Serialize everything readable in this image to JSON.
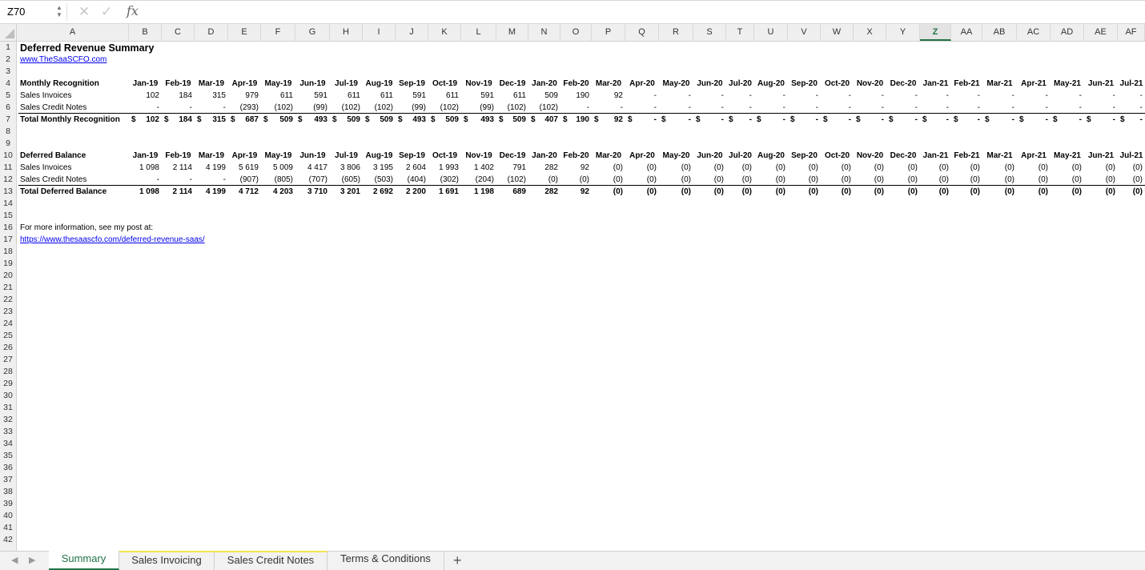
{
  "formula_bar": {
    "name_box": "Z70",
    "formula": "",
    "fx": "fx"
  },
  "columns": [
    "A",
    "B",
    "C",
    "D",
    "E",
    "F",
    "G",
    "H",
    "I",
    "J",
    "K",
    "L",
    "M",
    "N",
    "O",
    "P",
    "Q",
    "R",
    "S",
    "T",
    "U",
    "V",
    "W",
    "X",
    "Y",
    "Z",
    "AA",
    "AB",
    "AC",
    "AD",
    "AE",
    "AF"
  ],
  "active_column": "Z",
  "sheet": {
    "title": "Deferred Revenue Summary",
    "website": "www.TheSaaSCFO.com",
    "months": [
      "Jan-19",
      "Feb-19",
      "Mar-19",
      "Apr-19",
      "May-19",
      "Jun-19",
      "Jul-19",
      "Aug-19",
      "Sep-19",
      "Oct-19",
      "Nov-19",
      "Dec-19",
      "Jan-20",
      "Feb-20",
      "Mar-20",
      "Apr-20",
      "May-20",
      "Jun-20",
      "Jul-20",
      "Aug-20",
      "Sep-20",
      "Oct-20",
      "Nov-20",
      "Dec-20",
      "Jan-21",
      "Feb-21",
      "Mar-21",
      "Apr-21",
      "May-21",
      "Jun-21",
      "Jul-21"
    ],
    "monthly_recognition": {
      "header": "Monthly Recognition",
      "rows": [
        {
          "label": "Sales Invoices",
          "values": [
            "102",
            "184",
            "315",
            "979",
            "611",
            "591",
            "611",
            "611",
            "591",
            "611",
            "591",
            "611",
            "509",
            "190",
            "92",
            "-",
            "-",
            "-",
            "-",
            "-",
            "-",
            "-",
            "-",
            "-",
            "-",
            "-",
            "-",
            "-",
            "-",
            "-",
            "-"
          ]
        },
        {
          "label": "Sales Credit Notes",
          "values": [
            "-",
            "-",
            "-",
            "(293)",
            "(102)",
            "(99)",
            "(102)",
            "(102)",
            "(99)",
            "(102)",
            "(99)",
            "(102)",
            "(102)",
            "-",
            "-",
            "-",
            "-",
            "-",
            "-",
            "-",
            "-",
            "-",
            "-",
            "-",
            "-",
            "-",
            "-",
            "-",
            "-",
            "-",
            "-"
          ]
        }
      ],
      "total": {
        "label": "Total Monthly Recognition",
        "currency": "$",
        "values": [
          "102",
          "184",
          "315",
          "687",
          "509",
          "493",
          "509",
          "509",
          "493",
          "509",
          "493",
          "509",
          "407",
          "190",
          "92",
          "-",
          "-",
          "-",
          "-",
          "-",
          "-",
          "-",
          "-",
          "-",
          "-",
          "-",
          "-",
          "-",
          "-",
          "-",
          "-"
        ]
      }
    },
    "deferred_balance": {
      "header": "Deferred Balance",
      "rows": [
        {
          "label": "Sales Invoices",
          "values": [
            "1 098",
            "2 114",
            "4 199",
            "5 619",
            "5 009",
            "4 417",
            "3 806",
            "3 195",
            "2 604",
            "1 993",
            "1 402",
            "791",
            "282",
            "92",
            "(0)",
            "(0)",
            "(0)",
            "(0)",
            "(0)",
            "(0)",
            "(0)",
            "(0)",
            "(0)",
            "(0)",
            "(0)",
            "(0)",
            "(0)",
            "(0)",
            "(0)",
            "(0)",
            "(0)"
          ]
        },
        {
          "label": "Sales Credit Notes",
          "values": [
            "-",
            "-",
            "-",
            "(907)",
            "(805)",
            "(707)",
            "(605)",
            "(503)",
            "(404)",
            "(302)",
            "(204)",
            "(102)",
            "(0)",
            "(0)",
            "(0)",
            "(0)",
            "(0)",
            "(0)",
            "(0)",
            "(0)",
            "(0)",
            "(0)",
            "(0)",
            "(0)",
            "(0)",
            "(0)",
            "(0)",
            "(0)",
            "(0)",
            "(0)",
            "(0)"
          ]
        }
      ],
      "total": {
        "label": "Total Deferred Balance",
        "values": [
          "1 098",
          "2 114",
          "4 199",
          "4 712",
          "4 203",
          "3 710",
          "3 201",
          "2 692",
          "2 200",
          "1 691",
          "1 198",
          "689",
          "282",
          "92",
          "(0)",
          "(0)",
          "(0)",
          "(0)",
          "(0)",
          "(0)",
          "(0)",
          "(0)",
          "(0)",
          "(0)",
          "(0)",
          "(0)",
          "(0)",
          "(0)",
          "(0)",
          "(0)",
          "(0)"
        ]
      }
    },
    "info_text": "For more information, see my post at:",
    "info_link": "https://www.thesaascfo.com/deferred-revenue-saas/"
  },
  "row_count": 42,
  "tabs": [
    {
      "label": "Summary",
      "active": true
    },
    {
      "label": "Sales Invoicing",
      "active": false
    },
    {
      "label": "Sales Credit Notes",
      "active": false
    },
    {
      "label": "Terms & Conditions",
      "active": false
    }
  ],
  "add_sheet_label": "+",
  "colors": {
    "accent": "#217346",
    "link": "#0000ee",
    "tab_highlight": "#f2e64c"
  }
}
